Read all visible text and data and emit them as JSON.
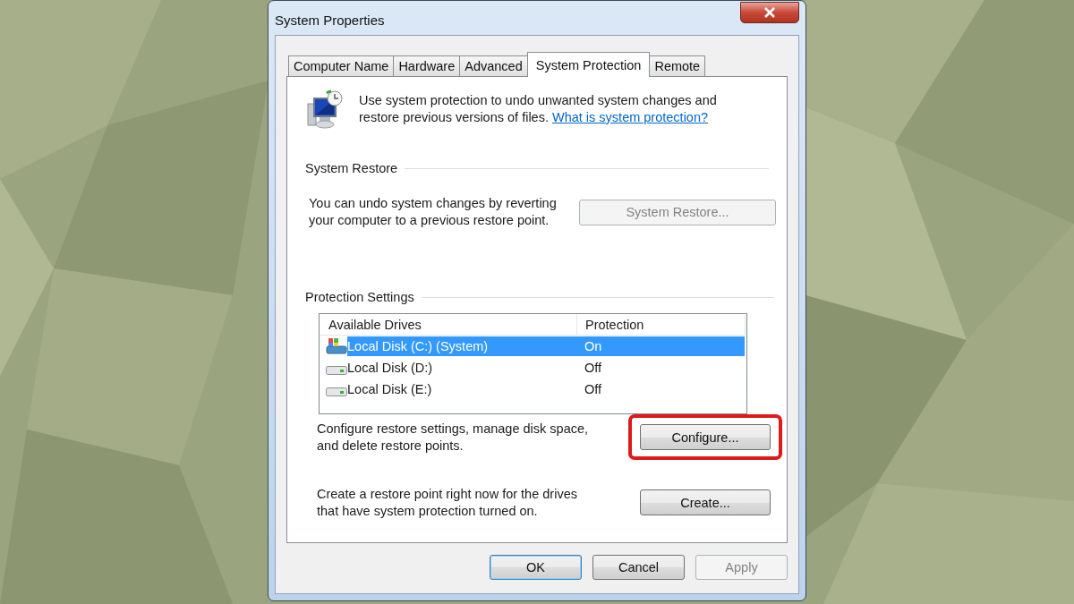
{
  "window": {
    "title": "System Properties"
  },
  "tabs": [
    {
      "label": "Computer Name",
      "selected": false
    },
    {
      "label": "Hardware",
      "selected": false
    },
    {
      "label": "Advanced",
      "selected": false
    },
    {
      "label": "System Protection",
      "selected": true
    },
    {
      "label": "Remote",
      "selected": false
    }
  ],
  "intro": {
    "text": "Use system protection to undo unwanted system changes and restore previous versions of files.",
    "link": "What is system protection?"
  },
  "system_restore": {
    "heading": "System Restore",
    "text": "You can undo system changes by reverting your computer to a previous restore point.",
    "button": {
      "label": "System Restore...",
      "disabled": true
    }
  },
  "protection_settings": {
    "heading": "Protection Settings",
    "columns": [
      "Available Drives",
      "Protection"
    ],
    "drives": [
      {
        "name": "Local Disk (C:) (System)",
        "protection": "On",
        "kind": "system",
        "selected": true
      },
      {
        "name": "Local Disk (D:)",
        "protection": "Off",
        "kind": "disk",
        "selected": false
      },
      {
        "name": "Local Disk (E:)",
        "protection": "Off",
        "kind": "disk",
        "selected": false
      }
    ],
    "actions": [
      {
        "text": "Configure restore settings, manage disk space, and delete restore points.",
        "button": {
          "label": "Configure...",
          "disabled": false,
          "highlighted": true
        }
      },
      {
        "text": "Create a restore point right now for the drives that have system protection turned on.",
        "button": {
          "label": "Create...",
          "disabled": false,
          "highlighted": false
        }
      }
    ]
  },
  "buttons": [
    {
      "label": "OK",
      "default": true,
      "disabled": false
    },
    {
      "label": "Cancel",
      "default": false,
      "disabled": false
    },
    {
      "label": "Apply",
      "default": false,
      "disabled": true
    }
  ]
}
